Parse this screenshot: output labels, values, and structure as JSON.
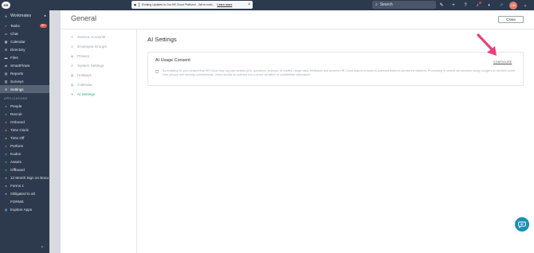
{
  "topbar": {
    "logo_text": "HR",
    "announcement": {
      "text": "Exciting Updates to Our HR Cloud Platform! - We're exch...",
      "link": "Learn more",
      "close": "×"
    },
    "search_placeholder": "Search",
    "icons": [
      "pencil-icon",
      "plus-icon",
      "help-icon",
      "bell-icon",
      "moon-icon",
      "rocket-icon",
      "avatar",
      "chevron-down-icon"
    ],
    "avatar_initials": "CM"
  },
  "sidebar": {
    "workmates": "Workmates",
    "items": [
      {
        "label": "Tasks",
        "icon": "check-icon",
        "badge": "99+"
      },
      {
        "label": "Chat",
        "icon": "chat-icon"
      },
      {
        "label": "Calendar",
        "icon": "calendar-icon"
      },
      {
        "label": "Directory",
        "icon": "directory-icon"
      },
      {
        "label": "Files",
        "icon": "folder-icon"
      },
      {
        "label": "SmartFlows",
        "icon": "flow-icon"
      },
      {
        "label": "Reports",
        "icon": "reports-icon"
      },
      {
        "label": "Surveys",
        "icon": "survey-icon"
      },
      {
        "label": "Settings",
        "icon": "gear-icon",
        "active": true
      }
    ],
    "section_label": "APPLICATIONS",
    "apps": [
      {
        "label": "People",
        "icon": "people-icon",
        "color": "#4aa3df"
      },
      {
        "label": "Recruit",
        "icon": "recruit-icon",
        "color": "#3cb371"
      },
      {
        "label": "Onboard",
        "icon": "onboard-icon",
        "color": "#e06666"
      },
      {
        "label": "Time Clock",
        "icon": "clock-icon",
        "color": "#e69138"
      },
      {
        "label": "Time Off",
        "icon": "time-off-icon",
        "color": "#e6b838"
      },
      {
        "label": "Perform",
        "icon": "perform-icon",
        "color": "#8e7cc3"
      },
      {
        "label": "Kudos",
        "icon": "kudos-icon",
        "color": "#4aa3df"
      },
      {
        "label": "Assets",
        "icon": "assets-icon",
        "color": "#3cb371"
      },
      {
        "label": "Offboard",
        "icon": "offboard-icon",
        "color": "#3cb371"
      },
      {
        "label": "12 Month Sign on Bonu",
        "icon": "user-icon",
        "color": "#aab3bd"
      },
      {
        "label": "Forms 1",
        "icon": "user-icon",
        "color": "#aab3bd"
      },
      {
        "label": "Obligated to all",
        "icon": "user-icon",
        "color": "#aab3bd"
      },
      {
        "label": "FORMS",
        "icon": "form-icon",
        "color": "#2d3a4e"
      },
      {
        "label": "Explore Apps",
        "icon": "grid-icon",
        "color": "#4aa3df"
      }
    ],
    "collapse": "‹"
  },
  "main": {
    "page_title": "General",
    "close_label": "Close",
    "subnav": [
      {
        "label": "Service Accounts",
        "icon": "service-accounts-icon"
      },
      {
        "label": "Employee Groups",
        "icon": "employee-groups-icon"
      },
      {
        "label": "Privacy",
        "icon": "privacy-icon"
      },
      {
        "label": "System Settings",
        "icon": "system-settings-icon"
      },
      {
        "label": "Holidays",
        "icon": "holidays-icon"
      },
      {
        "label": "Calendar",
        "icon": "calendar-icon"
      },
      {
        "label": "AI Settings",
        "icon": "ai-icon",
        "active": true
      }
    ],
    "content_title": "AI Settings",
    "card": {
      "title": "AI Usage Consent",
      "configure_label": "CONFIGURE",
      "description": "By enabling AI, you consent that HR Cloud may log user activity (IDs, questions, prompts, AI replies, usage data, feedback) and process HR Cloud data to provide AI-powered features across the platform. Processing is carried out securely using Google's AI services under their privacy and security commitments. Users should be advised not to share sensitive or confidential information.",
      "checked": false
    }
  },
  "colors": {
    "topbar": "#2d3a4e",
    "sidebar": "#2d3a4e",
    "active_green": "#2eaf7d",
    "arrow": "#e8407a",
    "chat_fab": "#1e8fb3"
  }
}
